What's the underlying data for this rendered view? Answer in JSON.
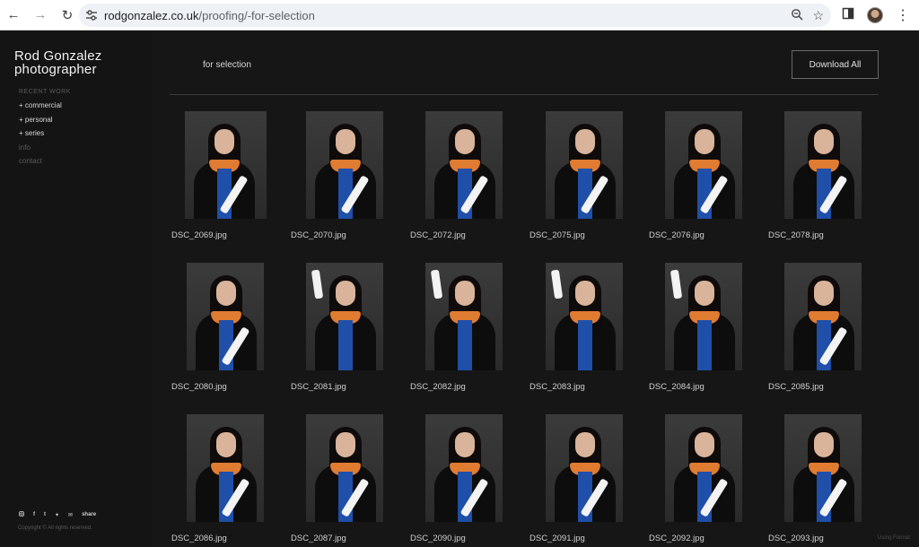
{
  "browser": {
    "url_host": "rodgonzalez.co.uk",
    "url_path": "/proofing/-for-selection"
  },
  "sidebar": {
    "logo_line1": "Rod Gonzalez",
    "logo_line2": "photographer",
    "nav_heading": "RECENT WORK",
    "nav_items": [
      {
        "label": "+ commercial"
      },
      {
        "label": "+ personal"
      },
      {
        "label": "+ series"
      },
      {
        "label": "info"
      },
      {
        "label": "contact"
      }
    ],
    "social_share_label": "share",
    "copyright": "Copyright © All rights reserved."
  },
  "main": {
    "gallery_title": "for selection",
    "download_all_label": "Download All",
    "photos": [
      {
        "filename": "DSC_2069.jpg"
      },
      {
        "filename": "DSC_2070.jpg"
      },
      {
        "filename": "DSC_2072.jpg"
      },
      {
        "filename": "DSC_2075.jpg"
      },
      {
        "filename": "DSC_2076.jpg"
      },
      {
        "filename": "DSC_2078.jpg"
      },
      {
        "filename": "DSC_2080.jpg"
      },
      {
        "filename": "DSC_2081.jpg"
      },
      {
        "filename": "DSC_2082.jpg"
      },
      {
        "filename": "DSC_2083.jpg"
      },
      {
        "filename": "DSC_2084.jpg"
      },
      {
        "filename": "DSC_2085.jpg"
      },
      {
        "filename": "DSC_2086.jpg"
      },
      {
        "filename": "DSC_2087.jpg"
      },
      {
        "filename": "DSC_2090.jpg"
      },
      {
        "filename": "DSC_2091.jpg"
      },
      {
        "filename": "DSC_2092.jpg"
      },
      {
        "filename": "DSC_2093.jpg"
      }
    ],
    "powered_by": "Using Format"
  }
}
